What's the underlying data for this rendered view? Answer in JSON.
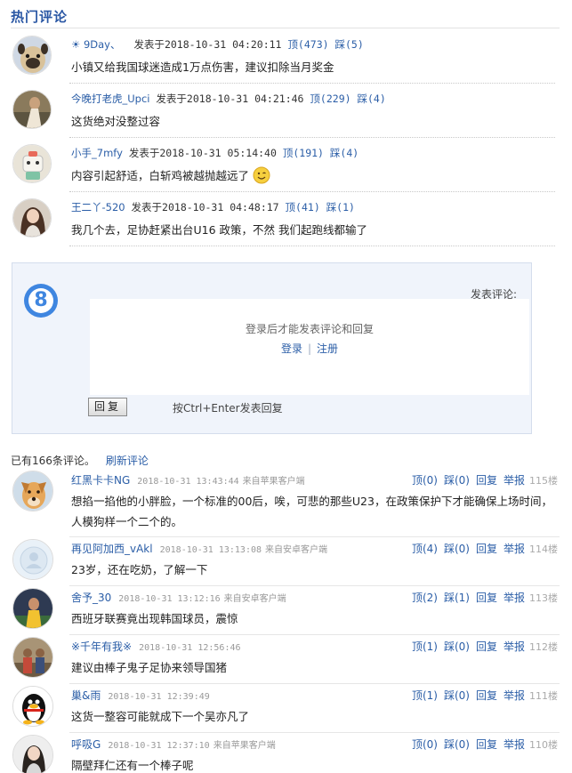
{
  "hot": {
    "title": "热门评论",
    "items": [
      {
        "user": "☀ 9Day、",
        "posted_prefix": "发表于",
        "time": "2018-10-31 04:20:11",
        "up": "顶(473)",
        "down": "踩(5)",
        "text": "小镇又给我国球迷造成1万点伤害，建议扣除当月奖金"
      },
      {
        "user": "今晚打老虎_Upci",
        "posted_prefix": "发表于",
        "time": "2018-10-31 04:21:46",
        "up": "顶(229)",
        "down": "踩(4)",
        "text": "这货绝对没整过容"
      },
      {
        "user": "小手_7mfy",
        "posted_prefix": "发表于",
        "time": "2018-10-31 05:14:40",
        "up": "顶(191)",
        "down": "踩(4)",
        "text": "内容引起舒适，白斩鸡被越抛越远了"
      },
      {
        "user": "王二丫-520",
        "posted_prefix": "发表于",
        "time": "2018-10-31 04:48:17",
        "up": "顶(41)",
        "down": "踩(1)",
        "text": "我几个去，足协赶紧出台U16 政策，不然 我们起跑线都输了"
      }
    ]
  },
  "reply_box": {
    "badge": "8",
    "form_label": "发表评论:",
    "login_hint": "登录后才能发表评论和回复",
    "login": "登录",
    "separator": "|",
    "register": "注册",
    "reply_button": "回复",
    "shortcut_hint": "按Ctrl+Enter发表回复"
  },
  "comments_header": {
    "count": "已有166条评论。",
    "refresh": "刷新评论"
  },
  "comments": [
    {
      "user": "红黑卡卡NG",
      "time": "2018-10-31 13:43:44",
      "source": "来自苹果客户端",
      "up": "顶(0)",
      "down": "踩(0)",
      "reply": "回复",
      "report": "举报",
      "floor": "115楼",
      "text": "想掐一掐他的小胖脸，一个标准的00后，唉，可悲的那些U23，在政策保护下才能确保上场时间，人模狗样一个二个的。"
    },
    {
      "user": "再见阿加西_vAkl",
      "time": "2018-10-31 13:13:08",
      "source": "来自安卓客户端",
      "up": "顶(4)",
      "down": "踩(0)",
      "reply": "回复",
      "report": "举报",
      "floor": "114楼",
      "text": "23岁，还在吃奶，了解一下"
    },
    {
      "user": "舍予_30",
      "time": "2018-10-31 13:12:16",
      "source": "来自安卓客户端",
      "up": "顶(2)",
      "down": "踩(1)",
      "reply": "回复",
      "report": "举报",
      "floor": "113楼",
      "text": "西班牙联赛竟出现韩国球员，震惊"
    },
    {
      "user": "※千年有我※",
      "time": "2018-10-31 12:56:46",
      "source": "",
      "up": "顶(1)",
      "down": "踩(0)",
      "reply": "回复",
      "report": "举报",
      "floor": "112楼",
      "text": "建议由棒子鬼子足协来领导国猪"
    },
    {
      "user": "巢&雨",
      "time": "2018-10-31 12:39:49",
      "source": "",
      "up": "顶(1)",
      "down": "踩(0)",
      "reply": "回复",
      "report": "举报",
      "floor": "111楼",
      "text": "这货一整容可能就成下一个吴亦凡了"
    },
    {
      "user": "呼吸G",
      "time": "2018-10-31 12:37:10",
      "source": "来自苹果客户端",
      "up": "顶(0)",
      "down": "踩(0)",
      "reply": "回复",
      "report": "举报",
      "floor": "110楼",
      "text": "隔壁拜仁还有一个棒子呢"
    }
  ]
}
